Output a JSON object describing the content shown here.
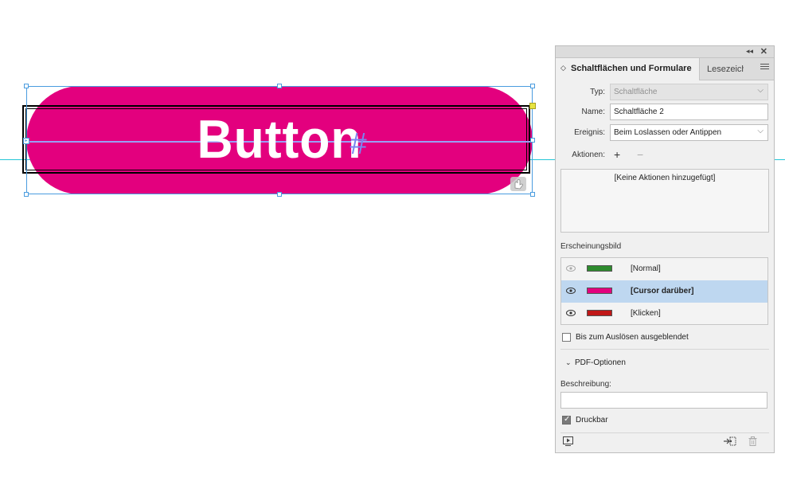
{
  "canvas": {
    "button_text": "Button",
    "overflow_marker": "#",
    "button_color": "#e3007e",
    "guide_color": "#24c6d6",
    "selection_color": "#4a9cdf"
  },
  "panel": {
    "collapse_glyph": "◂◂",
    "close_glyph": "✕",
    "tabs": {
      "active": "Schaltflächen und Formulare",
      "active_arrow": "◇",
      "inactive": "Lesezeichen"
    },
    "type": {
      "label": "Typ:",
      "value": "Schaltfläche"
    },
    "name": {
      "label": "Name:",
      "value": "Schaltfläche 2"
    },
    "event": {
      "label": "Ereignis:",
      "value": "Beim Loslassen oder Antippen"
    },
    "actions": {
      "label": "Aktionen:",
      "add_glyph": "+",
      "remove_glyph": "−",
      "empty_text": "[Keine Aktionen hinzugefügt]"
    },
    "appearance": {
      "label": "Erscheinungsbild",
      "states": [
        {
          "label": "[Normal]",
          "color": "#2e8b2e",
          "selected": false
        },
        {
          "label": "[Cursor darüber]",
          "color": "#e3007e",
          "selected": true
        },
        {
          "label": "[Klicken]",
          "color": "#c01818",
          "selected": false
        }
      ]
    },
    "hidden_until_triggered": {
      "label": "Bis zum Auslösen ausgeblendet",
      "checked": false
    },
    "pdf_options": {
      "toggle_glyph": "⌄",
      "label": "PDF-Optionen",
      "description_label": "Beschreibung:",
      "description_value": "",
      "printable": {
        "label": "Druckbar",
        "checked": true
      }
    },
    "selected_row_color": "#bed7f0"
  }
}
